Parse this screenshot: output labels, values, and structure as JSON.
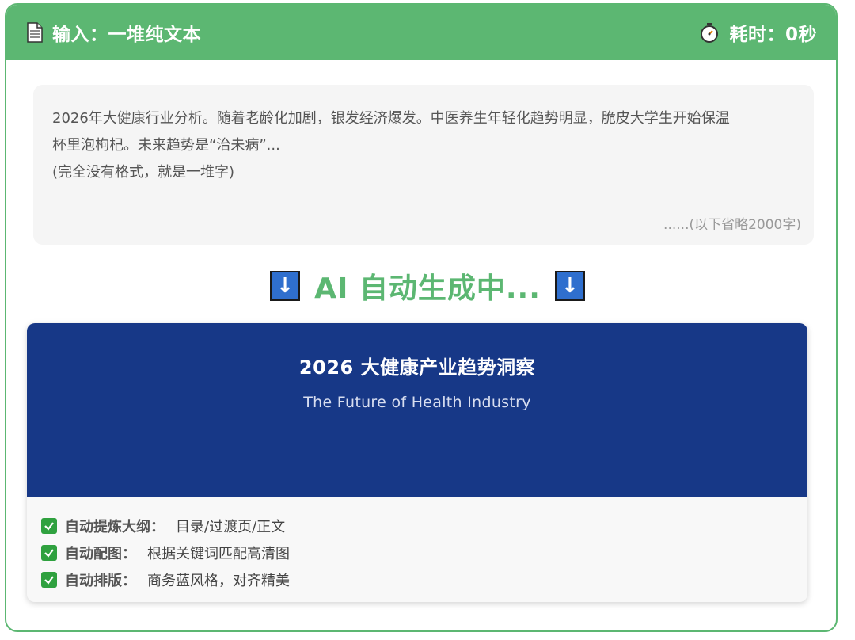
{
  "header": {
    "input_label": "输入：一堆纯文本",
    "time_label": "耗时：0秒",
    "doc_icon": "document-icon",
    "timer_icon": "stopwatch-icon"
  },
  "input": {
    "line1": "2026年大健康行业分析。随着老龄化加剧，银发经济爆发。中医养生年轻化趋势明显，脆皮大学生开始保温",
    "line2": "杯里泡枸杞。未来趋势是“治未病”...",
    "line3": "(完全没有格式，就是一堆字)",
    "omitted_note": "......(以下省略2000字)"
  },
  "generating": {
    "arrow": "↓",
    "text": "AI 自动生成中..."
  },
  "slide": {
    "title": "2026 大健康产业趋势洞察",
    "subtitle": "The Future of Health Industry",
    "features": [
      {
        "label": "自动提炼大纲：",
        "desc": "目录/过渡页/正文"
      },
      {
        "label": "自动配图：",
        "desc": "根据关键词匹配高清图"
      },
      {
        "label": "自动排版：",
        "desc": "商务蓝风格，对齐精美"
      }
    ]
  },
  "colors": {
    "accent_green": "#5cb772",
    "slide_blue": "#173887",
    "arrow_blue": "#2f6fce",
    "check_green": "#2fa13f"
  }
}
